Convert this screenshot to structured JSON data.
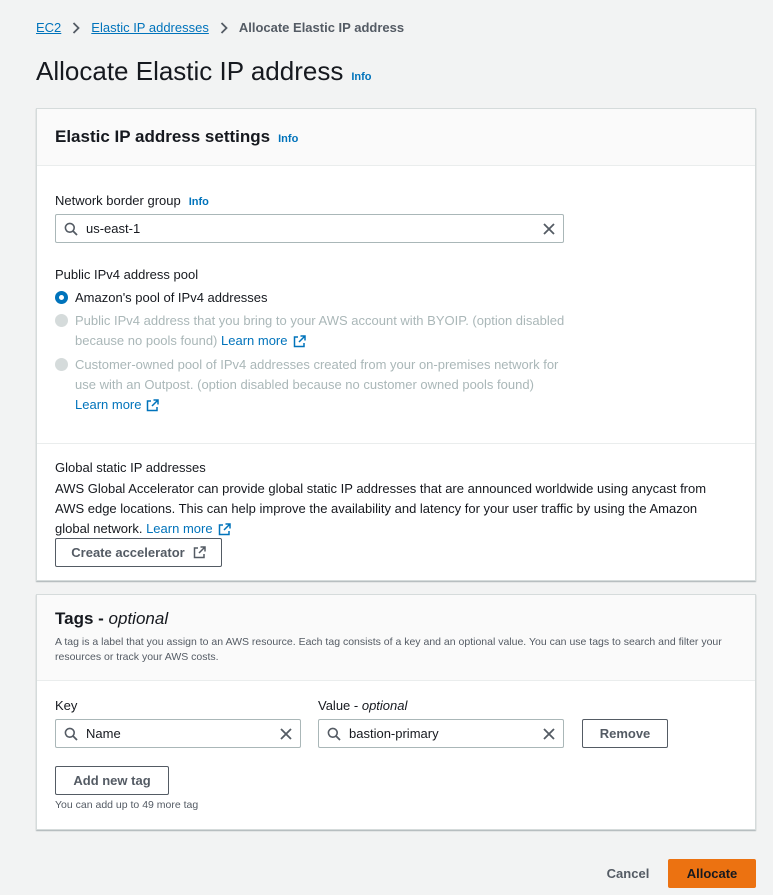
{
  "breadcrumb": {
    "items": [
      "EC2",
      "Elastic IP addresses"
    ],
    "current": "Allocate Elastic IP address"
  },
  "page": {
    "title": "Allocate Elastic IP address",
    "info": "Info"
  },
  "settings_panel": {
    "title": "Elastic IP address settings",
    "info": "Info",
    "network_border_group": {
      "label": "Network border group",
      "info": "Info",
      "value": "us-east-1"
    },
    "pool": {
      "label": "Public IPv4 address pool",
      "options": [
        {
          "text": "Amazon's pool of IPv4 addresses",
          "selected": true,
          "disabled": false
        },
        {
          "text": "Public IPv4 address that you bring to your AWS account with BYOIP. (option disabled because no pools found)",
          "link": "Learn more",
          "selected": false,
          "disabled": true
        },
        {
          "text": "Customer-owned pool of IPv4 addresses created from your on-premises network for use with an Outpost. (option disabled because no customer owned pools found)",
          "link": "Learn more",
          "selected": false,
          "disabled": true
        }
      ]
    },
    "global_static": {
      "title": "Global static IP addresses",
      "description": "AWS Global Accelerator can provide global static IP addresses that are announced worldwide using anycast from AWS edge locations. This can help improve the availability and latency for your user traffic by using the Amazon global network.",
      "link": "Learn more",
      "button": "Create accelerator"
    }
  },
  "tags_panel": {
    "title": "Tags - ",
    "title_optional": "optional",
    "description": "A tag is a label that you assign to an AWS resource. Each tag consists of a key and an optional value. You can use tags to search and filter your resources or track your AWS costs.",
    "key_label": "Key",
    "value_label": "Value - ",
    "value_label_optional": "optional",
    "tags": [
      {
        "key": "Name",
        "value": "bastion-primary"
      }
    ],
    "remove_button": "Remove",
    "add_button": "Add new tag",
    "hint": "You can add up to 49 more tag"
  },
  "footer": {
    "cancel": "Cancel",
    "allocate": "Allocate"
  },
  "colors": {
    "link": "#0073bb",
    "primary": "#ec7211",
    "background": "#f2f3f3",
    "disabled": "#aab7b8"
  }
}
